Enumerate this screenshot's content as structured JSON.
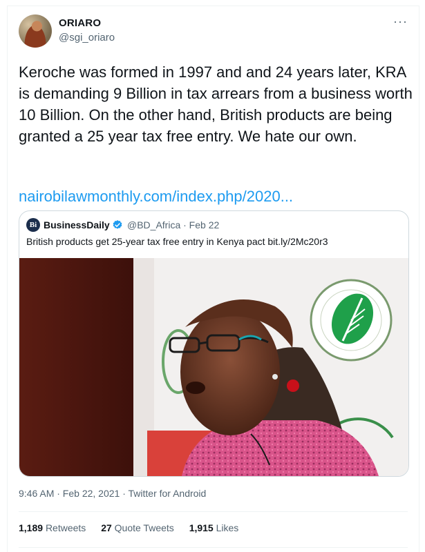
{
  "author": {
    "name": "ORIARO",
    "handle": "@sgi_oriaro",
    "more_icon": "more-horizontal-icon"
  },
  "tweet": {
    "text": "Keroche was formed in 1997 and and 24 years later, KRA is demanding 9 Billion in tax arrears from a business worth 10 Billion. On the other hand, British products are being granted a 25 year tax free entry. We hate our own.",
    "link": "nairobilawmonthly.com/index.php/2020..."
  },
  "quoted_tweet": {
    "logo_text": "Bi",
    "name": "BusinessDaily",
    "verified_icon": "verified-badge-icon",
    "handle_date": "@BD_Africa · Feb 22",
    "text": "British products get 25-year tax free entry in Kenya pact bit.ly/2Mc20r3"
  },
  "meta": {
    "timestamp": "9:46 AM · Feb 22, 2021 · Twitter for Android"
  },
  "stats": {
    "retweets_count": "1,189",
    "retweets_label": "Retweets",
    "quotes_count": "27",
    "quotes_label": "Quote Tweets",
    "likes_count": "1,915",
    "likes_label": "Likes"
  },
  "colors": {
    "link": "#1d9bf0",
    "verified": "#1d9bf0",
    "secondary_text": "#536471"
  }
}
